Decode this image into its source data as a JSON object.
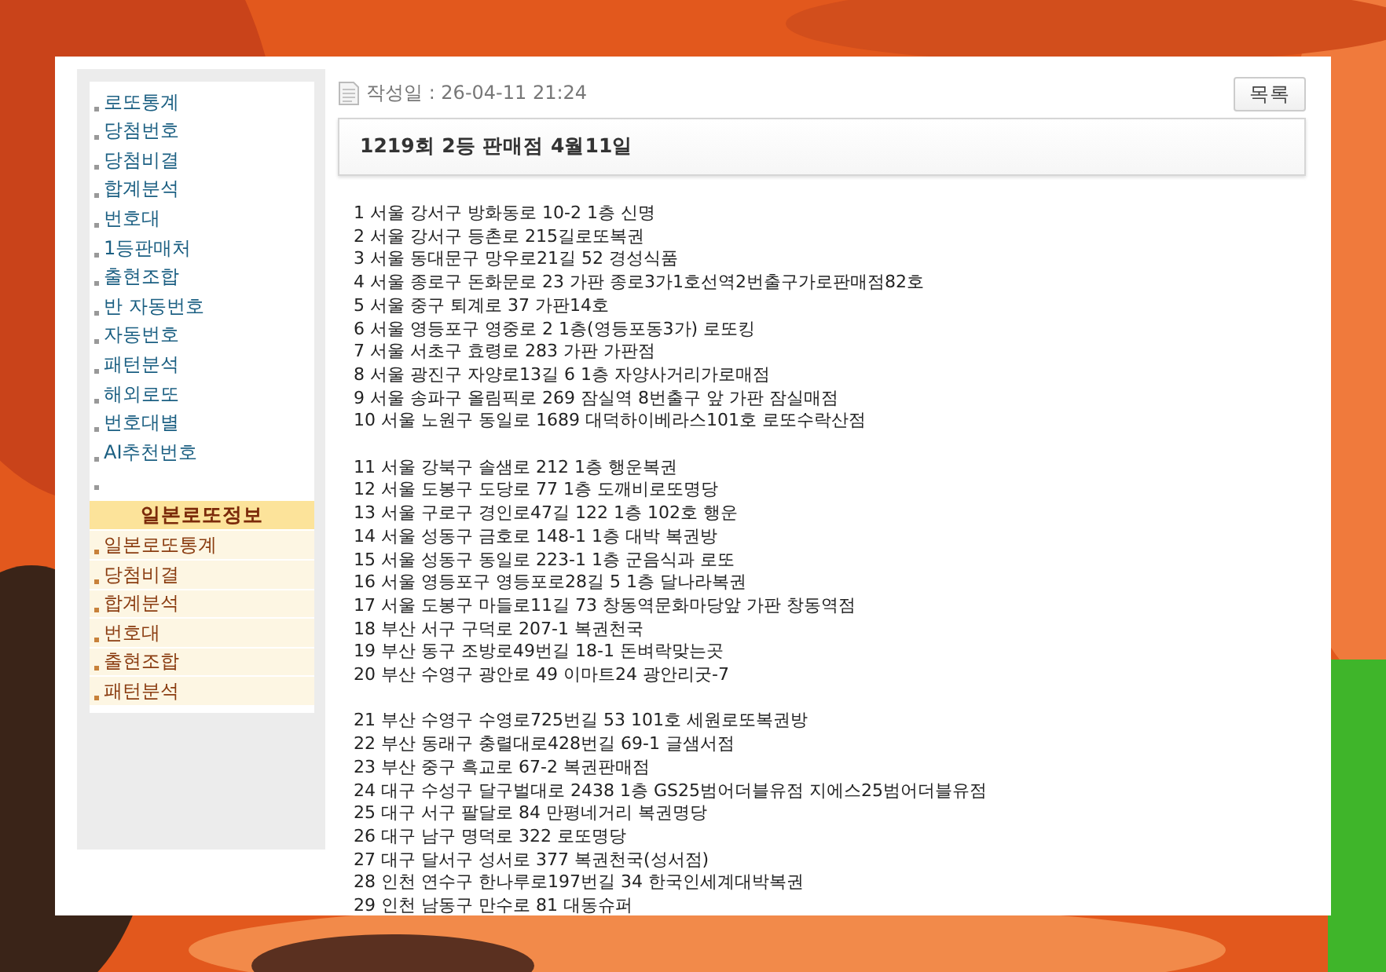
{
  "sidebar": {
    "items": [
      {
        "kind": "link",
        "label": "로또통계"
      },
      {
        "kind": "link",
        "label": "당첨번호"
      },
      {
        "kind": "link",
        "label": "당첨비결"
      },
      {
        "kind": "link",
        "label": "합계분석"
      },
      {
        "kind": "link",
        "label": "번호대"
      },
      {
        "kind": "link",
        "label": "1등판매처"
      },
      {
        "kind": "link",
        "label": "출현조합"
      },
      {
        "kind": "link",
        "label": "반 자동번호"
      },
      {
        "kind": "link",
        "label": "자동번호"
      },
      {
        "kind": "link",
        "label": "패턴분석"
      },
      {
        "kind": "link",
        "label": "해외로또"
      },
      {
        "kind": "link",
        "label": "번호대별"
      },
      {
        "kind": "link",
        "label": "AI추천번호"
      },
      {
        "kind": "bullet"
      }
    ],
    "section_title": "일본로또정보",
    "section_items": [
      {
        "kind": "link",
        "label": "일본로또통계"
      },
      {
        "kind": "link",
        "label": "당첨비결"
      },
      {
        "kind": "link",
        "label": "합계분석"
      },
      {
        "kind": "link",
        "label": "번호대"
      },
      {
        "kind": "link",
        "label": "출현조합"
      },
      {
        "kind": "link",
        "label": "패턴분석"
      }
    ]
  },
  "post": {
    "date_label": "작성일 : 26-04-11 21:24",
    "list_button": "목록",
    "title": "1219회 2등 판매점 4월11일",
    "groups": [
      [
        "1 서울 강서구 방화동로 10-2 1층 신명",
        "2 서울 강서구 등촌로 215길로또복권",
        "3 서울 동대문구 망우로21길 52 경성식품",
        "4 서울 종로구 돈화문로 23 가판 종로3가1호선역2번출구가로판매점82호",
        "5 서울 중구 퇴계로 37 가판14호",
        "6 서울 영등포구 영중로 2 1층(영등포동3가) 로또킹",
        "7 서울 서초구 효령로 283 가판 가판점",
        "8 서울 광진구 자양로13길 6 1층 자양사거리가로매점",
        "9 서울 송파구 올림픽로 269 잠실역 8번출구 앞 가판 잠실매점",
        "10 서울 노원구 동일로 1689 대덕하이베라스101호 로또수락산점"
      ],
      [
        "11 서울 강북구 솔샘로 212 1층 행운복권",
        "12 서울 도봉구 도당로 77 1층 도깨비로또명당",
        "13 서울 구로구 경인로47길 122 1층 102호 행운",
        "14 서울 성동구 금호로 148-1 1층 대박 복권방",
        "15 서울 성동구 동일로 223-1 1층 군음식과 로또",
        "16 서울 영등포구 영등포로28길 5 1층 달나라복권",
        "17 서울 도봉구 마들로11길 73 창동역문화마당앞 가판 창동역점",
        "18 부산 서구 구덕로 207-1 복권천국",
        "19 부산 동구 조방로49번길 18-1 돈벼락맞는곳",
        "20 부산 수영구 광안로 49 이마트24 광안리굿-7"
      ],
      [
        "21 부산 수영구 수영로725번길 53 101호 세원로또복권방",
        "22 부산 동래구 충렬대로428번길 69-1 글샘서점",
        "23 부산 중구 흑교로 67-2 복권판매점",
        "24 대구 수성구 달구벌대로 2438 1층 GS25범어더블유점 지에스25범어더블유점",
        "25 대구 서구 팔달로 84 만평네거리 복권명당",
        "26 대구 남구 명덕로 322 로또명당",
        "27 대구 달서구 성서로 377 복권천국(성서점)",
        "28 인천 연수구 한나루로197번길 34 한국인세계대박복권",
        "29 인천 남동구 만수로 81 대동슈퍼"
      ]
    ]
  }
}
